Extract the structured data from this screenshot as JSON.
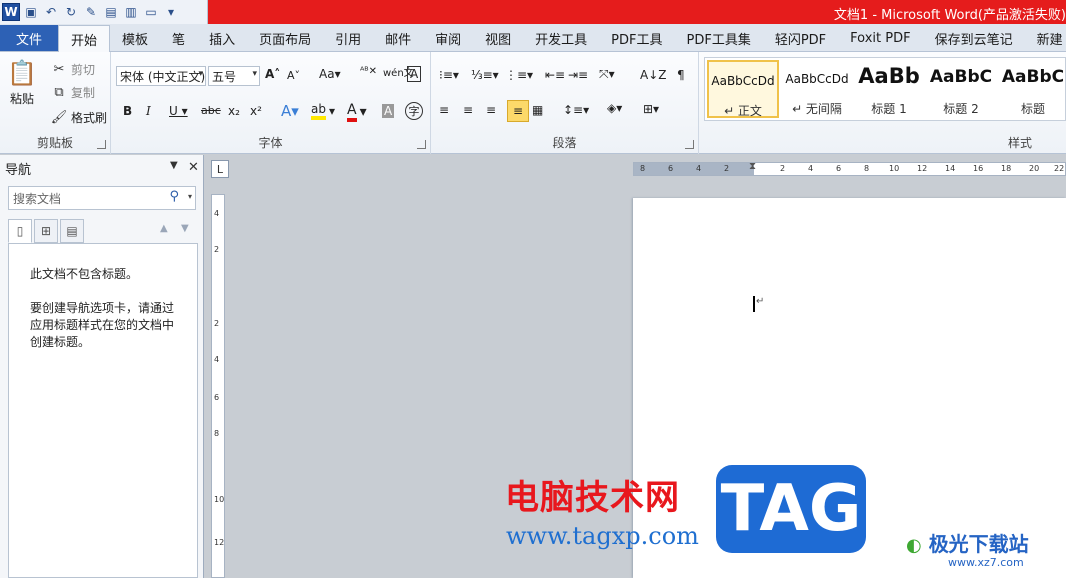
{
  "window": {
    "title": "文档1 - Microsoft Word(产品激活失败)"
  },
  "qat": {
    "logo": "W"
  },
  "tabs": [
    "文件",
    "开始",
    "模板",
    "笔",
    "插入",
    "页面布局",
    "引用",
    "邮件",
    "审阅",
    "视图",
    "开发工具",
    "PDF工具",
    "PDF工具集",
    "轻闪PDF",
    "Foxit PDF",
    "保存到云笔记",
    "新建"
  ],
  "ribbon": {
    "clipboard": {
      "label": "剪贴板",
      "paste": "粘贴",
      "cut": "剪切",
      "copy": "复制",
      "format_painter": "格式刷"
    },
    "font": {
      "label": "字体",
      "font_name": "宋体 (中文正文)",
      "font_size": "五号"
    },
    "paragraph": {
      "label": "段落"
    },
    "styles": {
      "label": "样式",
      "items": [
        {
          "preview": "AaBbCcDd",
          "name": "↵ 正文"
        },
        {
          "preview": "AaBbCcDd",
          "name": "↵ 无间隔"
        },
        {
          "preview": "AaBb",
          "name": "标题 1"
        },
        {
          "preview": "AaBbC",
          "name": "标题 2"
        },
        {
          "preview": "AaBbC",
          "name": "标题"
        }
      ]
    }
  },
  "nav": {
    "title": "导航",
    "search_placeholder": "搜索文档",
    "empty_line1": "此文档不包含标题。",
    "empty_line2a": "要创建导航选项卡，请通过",
    "empty_line2b": "应用标题样式在您的文档中",
    "empty_line2c": "创建标题。"
  },
  "ruler": {
    "h_ticks": [
      "8",
      "6",
      "4",
      "2",
      "2",
      "4",
      "6",
      "8",
      "10",
      "12",
      "14",
      "16",
      "18",
      "20",
      "22"
    ],
    "v_ticks": [
      "4",
      "2",
      "2",
      "4",
      "6",
      "8",
      "10",
      "12"
    ]
  },
  "watermark": {
    "site_cn": "电脑技术网",
    "site_url": "www.tagxp.com",
    "tag": "TAG",
    "brand2": "极光下载站",
    "brand2_url": "www.xz7.com"
  }
}
